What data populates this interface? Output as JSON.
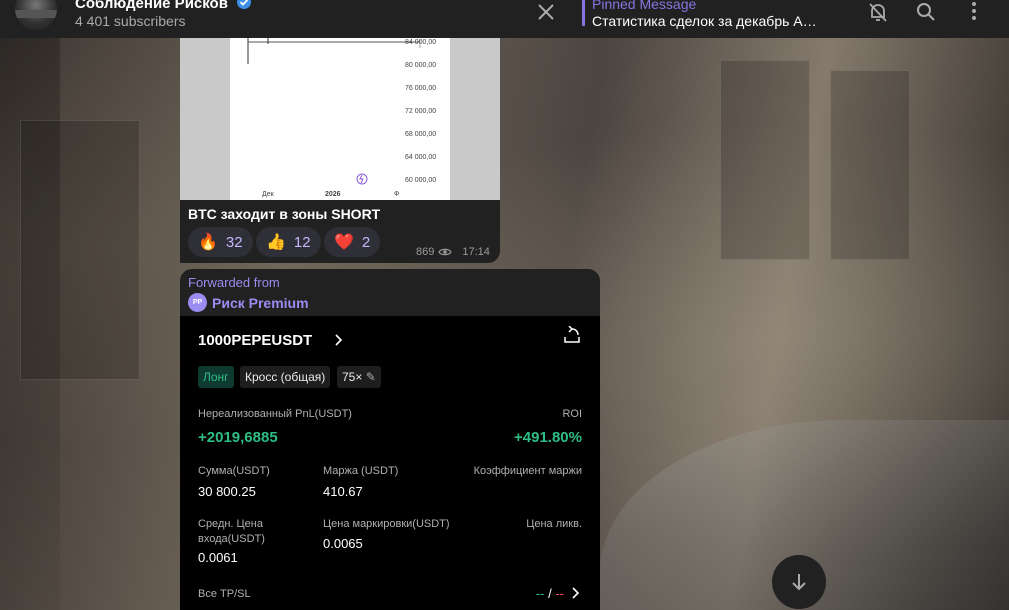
{
  "header": {
    "channel_title": "Соблюдение Рисков",
    "subscribers": "4 401 subscribers",
    "pinned_label": "Pinned Message",
    "pinned_text": "Статистика сделок за декабрь ALL..."
  },
  "message1": {
    "chart": {
      "y_ticks": [
        "84 000,00",
        "80 000,00",
        "76 000,00",
        "72 000,00",
        "68 000,00",
        "64 000,00",
        "60 000,00"
      ],
      "x_ticks": [
        "Дек",
        "2026",
        "Ф"
      ]
    },
    "caption": "BTC заходит в зоны SHORT",
    "reactions": [
      {
        "emoji": "🔥",
        "count": "32"
      },
      {
        "emoji": "👍",
        "count": "12"
      },
      {
        "emoji": "❤️",
        "count": "2"
      }
    ],
    "views": "869",
    "time": "17:14"
  },
  "message2": {
    "forwarded_label": "Forwarded from",
    "source_initials": "PP",
    "source_name": "Риск Premium",
    "card": {
      "symbol": "1000PEPEUSDT",
      "side": "Лонг",
      "margin_mode": "Кросс (общая)",
      "leverage": "75×",
      "unrealized_label": "Нереализованный PnL(USDT)",
      "roi_label": "ROI",
      "unrealized_value": "+2019,6885",
      "roi_value": "+491.80%",
      "size_label": "Сумма(USDT)",
      "size_value": "30 800.25",
      "margin_label": "Маржа (USDT)",
      "margin_value": "410.67",
      "ratio_label": "Коэффициент маржи",
      "entry_label_1": "Средн. Цена",
      "entry_label_2": "входа(USDT)",
      "entry_value": "0.0061",
      "mark_label": "Цена маркировки(USDT)",
      "mark_value": "0.0065",
      "liq_label": "Цена ликв.",
      "tpsl_label": "Все TP/SL",
      "tpsl_value_a": "--",
      "tpsl_sep": "/",
      "tpsl_value_b": "--"
    }
  },
  "colors": {
    "accent": "#8774e1",
    "header_bg": "#212121",
    "profit_green": "#2ebd85",
    "loss_red": "#f6465d"
  }
}
